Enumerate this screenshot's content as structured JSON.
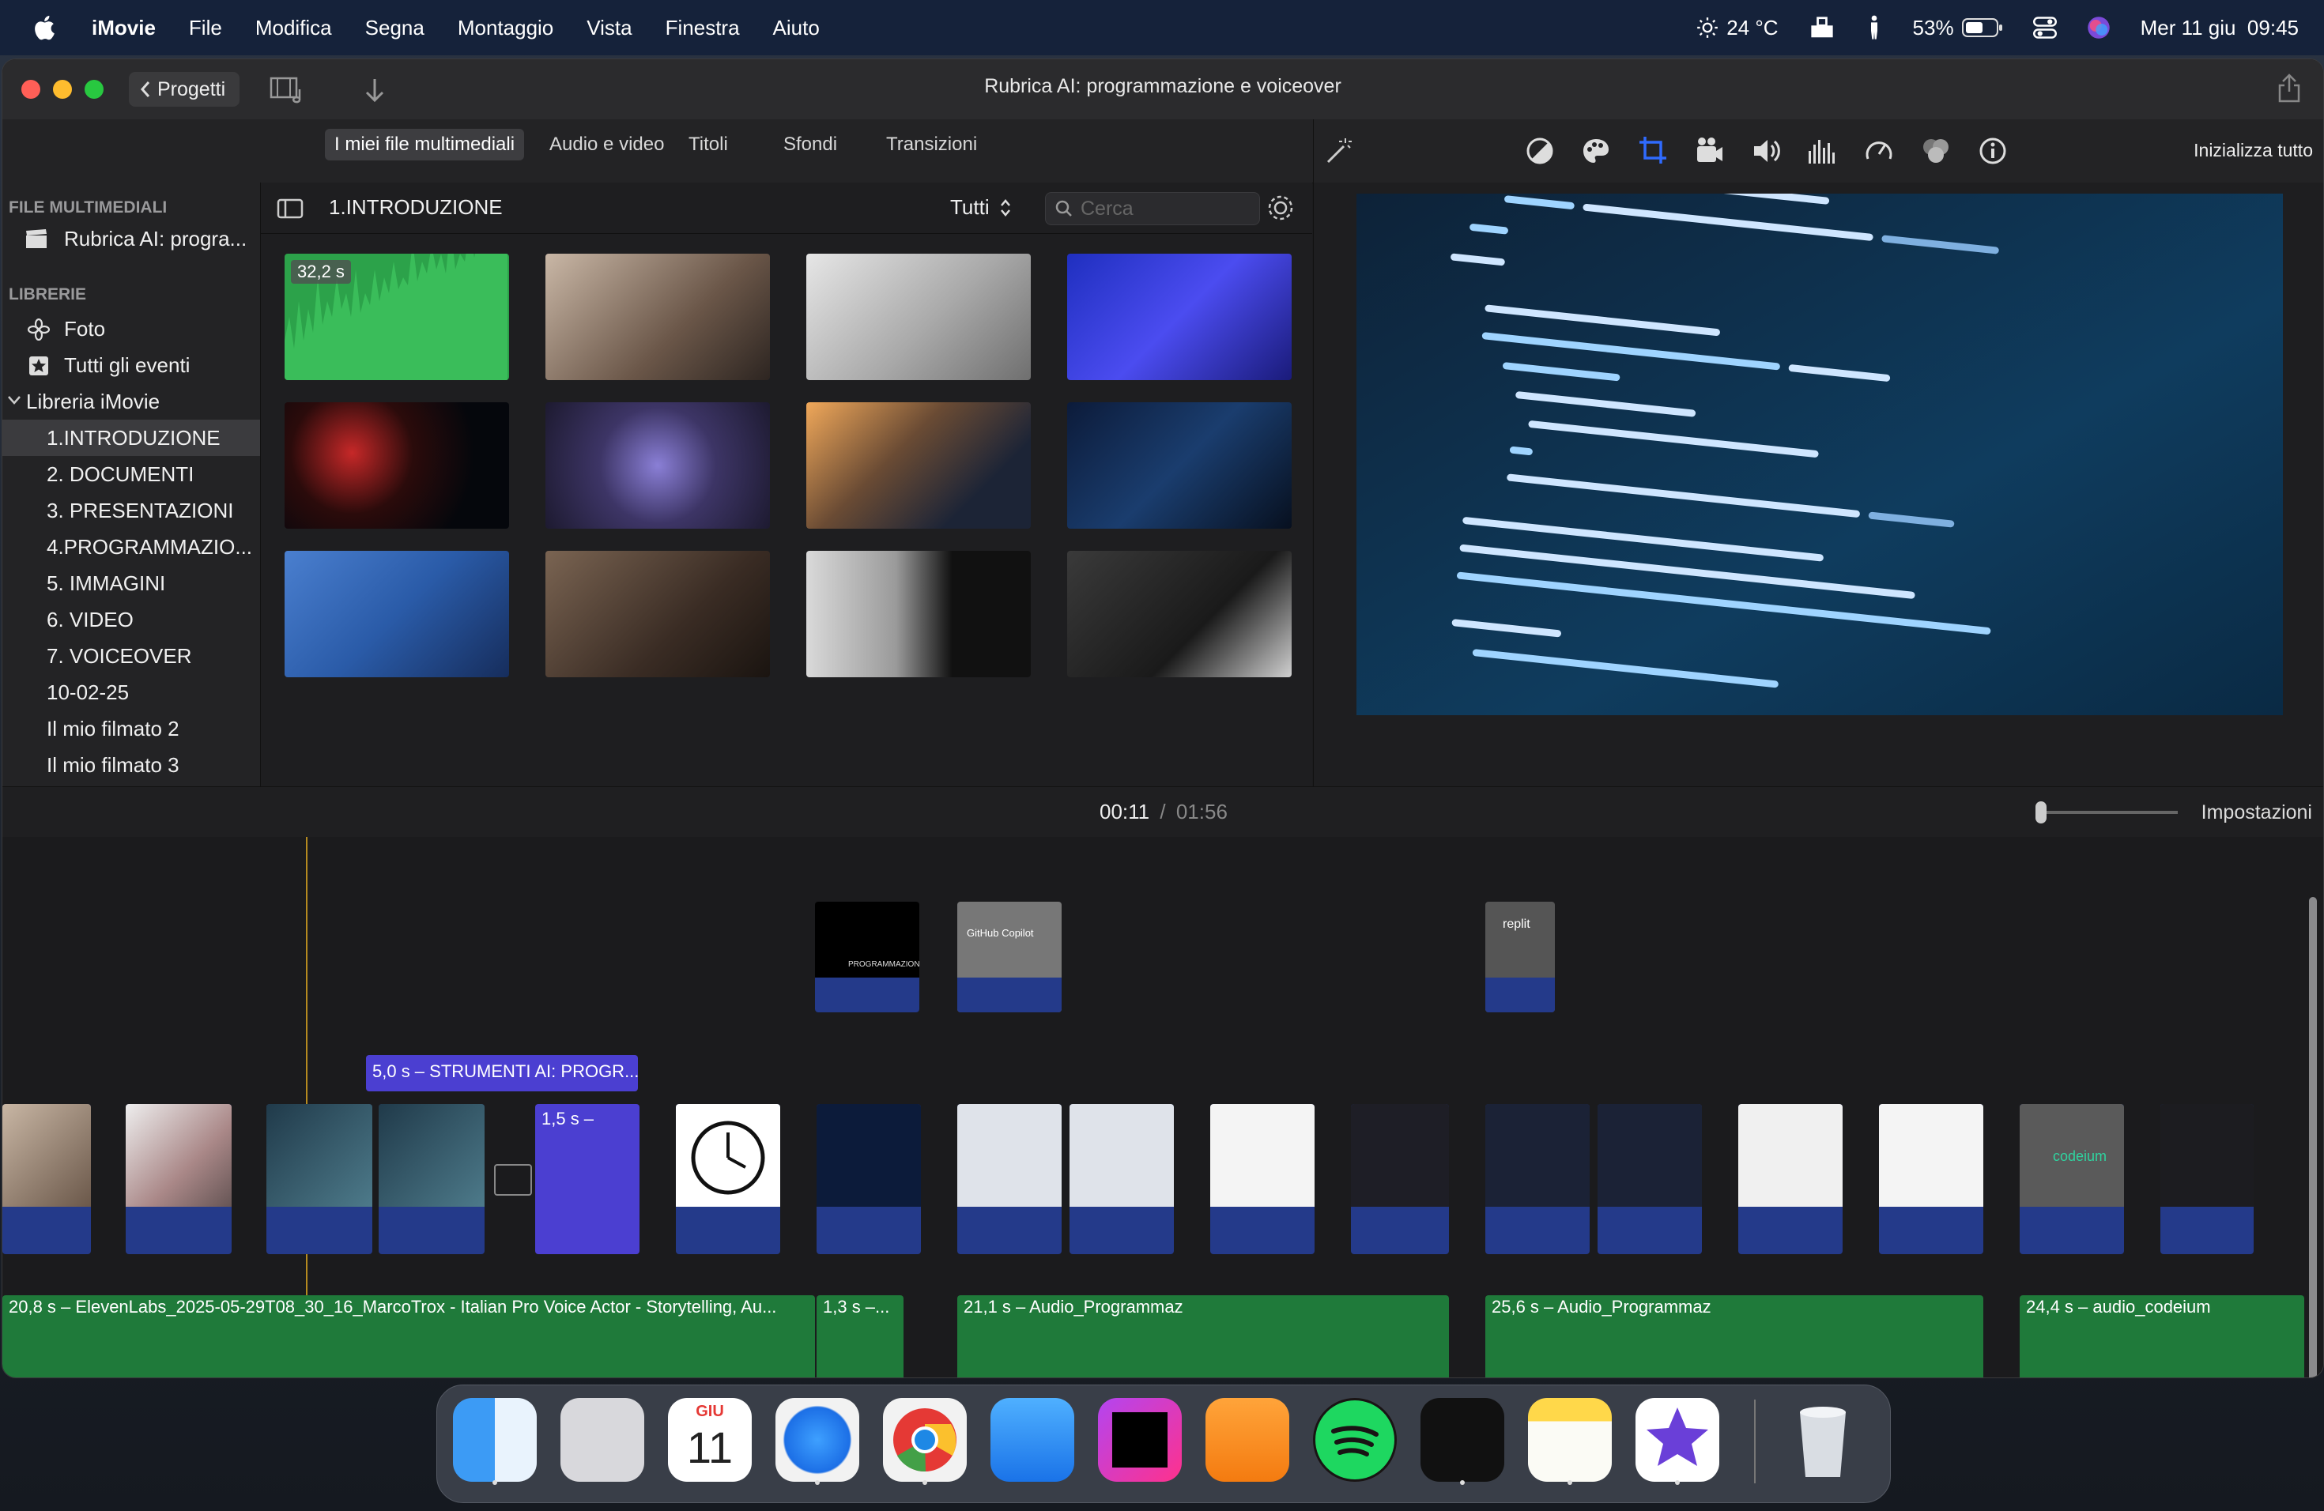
{
  "menubar": {
    "app": "iMovie",
    "items": [
      "File",
      "Modifica",
      "Segna",
      "Montaggio",
      "Vista",
      "Finestra",
      "Aiuto"
    ],
    "weather": "24 °C",
    "battery": "53%",
    "datetime": "Mer 11 giu  09:45"
  },
  "window": {
    "projects_label": "Progetti",
    "title": "Rubrica AI: programmazione e voiceover"
  },
  "browser_tabs": [
    "I miei file multimediali",
    "Audio e video",
    "Titoli",
    "Sfondi",
    "Transizioni"
  ],
  "sidebar": {
    "media_header": "FILE MULTIMEDIALI",
    "project_item": "Rubrica AI: progra...",
    "libraries_header": "LIBRERIE",
    "photos": "Foto",
    "all_events": "Tutti gli eventi",
    "library": "Libreria iMovie",
    "events": [
      "1.INTRODUZIONE",
      "2. DOCUMENTI",
      "3. PRESENTAZIONI",
      "4.PROGRAMMAZIO...",
      "5. IMMAGINI",
      "6. VIDEO",
      "7. VOICEOVER",
      "10-02-25",
      "Il mio filmato 2",
      "Il mio filmato 3"
    ]
  },
  "media": {
    "event_title": "1.INTRODUZIONE",
    "filter": "Tutti",
    "search_placeholder": "Cerca",
    "first_duration": "32,2 s"
  },
  "viewer": {
    "reset_all": "Inizializza tutto"
  },
  "timeline": {
    "current_time": "00:11",
    "separator": "/",
    "total_time": "01:56",
    "settings": "Impostazioni",
    "title_clip": "5,0 s – STRUMENTI AI: PROGR...",
    "purple_clip": "1,5 s –",
    "audio_clips": [
      "20,8 s – ElevenLabs_2025-05-29T08_30_16_MarcoTrox - Italian Pro Voice Actor - Storytelling, Au...",
      "1,3 s –...",
      "21,1 s – Audio_Programmaz",
      "25,6 s – Audio_Programmaz",
      "24,4 s – audio_codeium"
    ],
    "thumb_text": {
      "github": "GitHub Copilot",
      "replit": "replit",
      "codeium": "codeium",
      "programmazione": "PROGRAMMAZIONE"
    }
  },
  "dock": {
    "apps": [
      "Finder",
      "Launchpad",
      "Calendario",
      "Safari",
      "Chrome",
      "Mail",
      "PhpStorm",
      "Pages",
      "Spotify",
      "Webex",
      "Note",
      "iMovie",
      "Cestino"
    ],
    "calendar_month": "GIU",
    "calendar_day": "11"
  },
  "colors": {
    "accent_blue": "#2f6bff",
    "clip_blue": "#243a8a",
    "audio_green": "#1f7a3a",
    "title_purple": "#4b3fd1"
  }
}
